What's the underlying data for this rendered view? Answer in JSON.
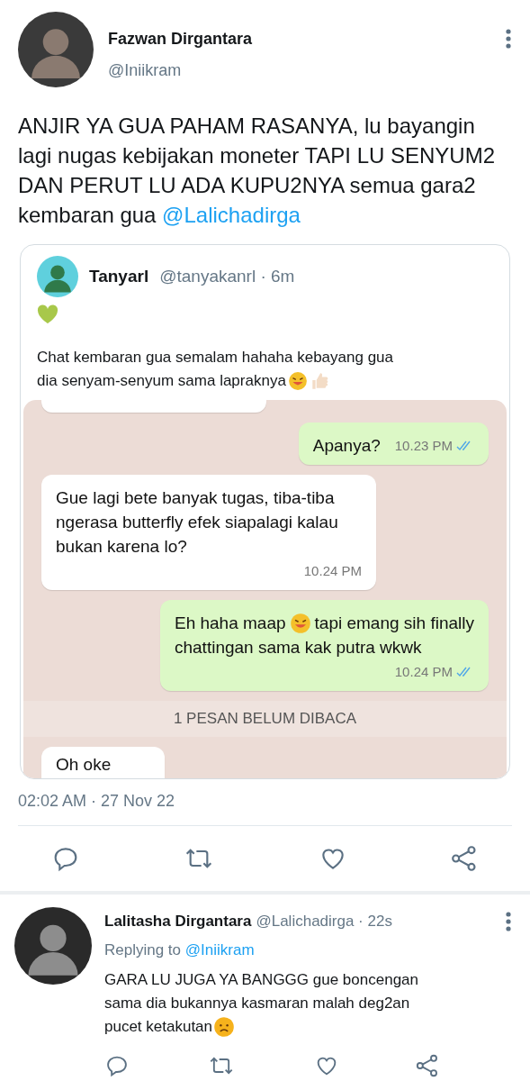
{
  "tweet": {
    "name": "Fazwan Dirgantara",
    "handle": "@Iniikram",
    "text": "ANJIR YA GUA PAHAM RASANYA, lu bayangin lagi nugas kebijakan moneter TAPI LU SENYUM2 DAN PERUT LU ADA KUPU2NYA semua gara2 kembaran gua ",
    "mention": "@Lalichadirga",
    "quote": {
      "name": "Tanyarl",
      "handle": "@tanyakanrl",
      "time": "· 6m",
      "lines": [
        "Chat kembaran gua semalam hahaha kebayang gua",
        "dia senyam-senyum sama lapraknya"
      ],
      "chat": [
        {
          "kind": "cut",
          "outgoing": false
        },
        {
          "kind": "message",
          "outgoing": true,
          "text": "Apanya?",
          "time": "10.23 PM",
          "read": true
        },
        {
          "kind": "message",
          "outgoing": false,
          "text": "Gue lagi bete banyak tugas, tiba-tiba ngerasa butterfly efek siapalagi kalau bukan karena lo?",
          "time": "10.24 PM"
        },
        {
          "kind": "message",
          "outgoing": true,
          "text": "Eh haha maap",
          "text_after": "tapi emang sih finally",
          "text_line2": "chattingan sama kak putra wkwk",
          "time": "10.24 PM",
          "read": true
        },
        {
          "kind": "banner",
          "text": "1 PESAN BELUM DIBACA"
        },
        {
          "kind": "partial",
          "outgoing": false,
          "text": "Oh oke"
        }
      ]
    },
    "timestamp": "02:02 AM · 27 Nov 22"
  },
  "reply": {
    "name": "Lalitasha Dirgantara",
    "handle": "@Lalichadirga",
    "time": "· 22s",
    "replying_label": "Replying to ",
    "replying_to": "@Iniikram",
    "lines": [
      "GARA LU JUGA YA BANGGG gue boncengan",
      "sama dia bukannya kasmaran malah deg2an",
      "pucet ketakutan"
    ]
  }
}
